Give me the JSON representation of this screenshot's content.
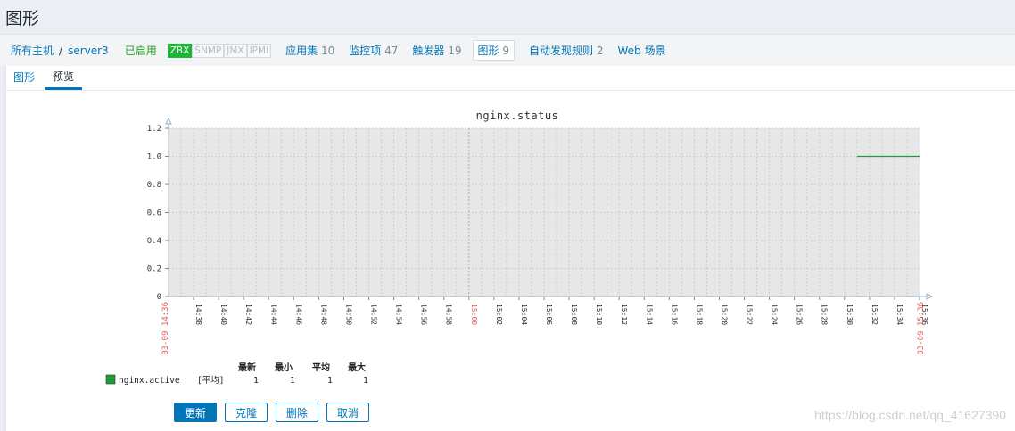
{
  "page": {
    "title": "图形"
  },
  "breadcrumb": {
    "all_hosts": "所有主机",
    "separator": "/",
    "host": "server3",
    "status": "已启用",
    "availability": [
      "ZBX",
      "SNMP",
      "JMX",
      "IPMI"
    ]
  },
  "nav_items": [
    {
      "label": "应用集",
      "count": "10"
    },
    {
      "label": "监控项",
      "count": "47"
    },
    {
      "label": "触发器",
      "count": "19"
    },
    {
      "label": "图形",
      "count": "9"
    },
    {
      "label": "自动发现规则",
      "count": "2"
    },
    {
      "label": "Web 场景",
      "count": ""
    }
  ],
  "tabs": [
    "图形",
    "预览"
  ],
  "chart_data": {
    "type": "line",
    "title": "nginx.status",
    "ylim": [
      0,
      1.2
    ],
    "y_ticks": [
      "0",
      "0.2",
      "0.4",
      "0.6",
      "0.8",
      "1.0",
      "1.2"
    ],
    "x_range": [
      "14:36",
      "15:36"
    ],
    "x_ticks": [
      "14:38",
      "14:40",
      "14:42",
      "14:44",
      "14:46",
      "14:48",
      "14:50",
      "14:52",
      "14:54",
      "14:56",
      "14:58",
      "15:00",
      "15:02",
      "15:04",
      "15:06",
      "15:08",
      "15:10",
      "15:12",
      "15:14",
      "15:16",
      "15:18",
      "15:20",
      "15:22",
      "15:24",
      "15:26",
      "15:28",
      "15:30",
      "15:32",
      "15:34",
      "15:36"
    ],
    "x_start_label": "03-09 14:36",
    "x_end_label": "03-09 15:36",
    "grid": true,
    "series": [
      {
        "name": "nginx.active",
        "color": "#1a9e34",
        "x": [
          "15:31",
          "15:36"
        ],
        "y": [
          1,
          1
        ]
      }
    ],
    "legend": {
      "headers": [
        "最新",
        "最小",
        "平均",
        "最大"
      ],
      "rows": [
        {
          "name": "nginx.active",
          "func": "[平均]",
          "last": "1",
          "min": "1",
          "avg": "1",
          "max": "1"
        }
      ]
    }
  },
  "buttons": {
    "update": "更新",
    "clone": "克隆",
    "delete": "删除",
    "cancel": "取消"
  },
  "watermark": "https://blog.csdn.net/qq_41627390",
  "colors": {
    "link": "#0275b8",
    "enabled": "#22a31b",
    "zbx": "#1db536",
    "highlight": "#e45959"
  }
}
